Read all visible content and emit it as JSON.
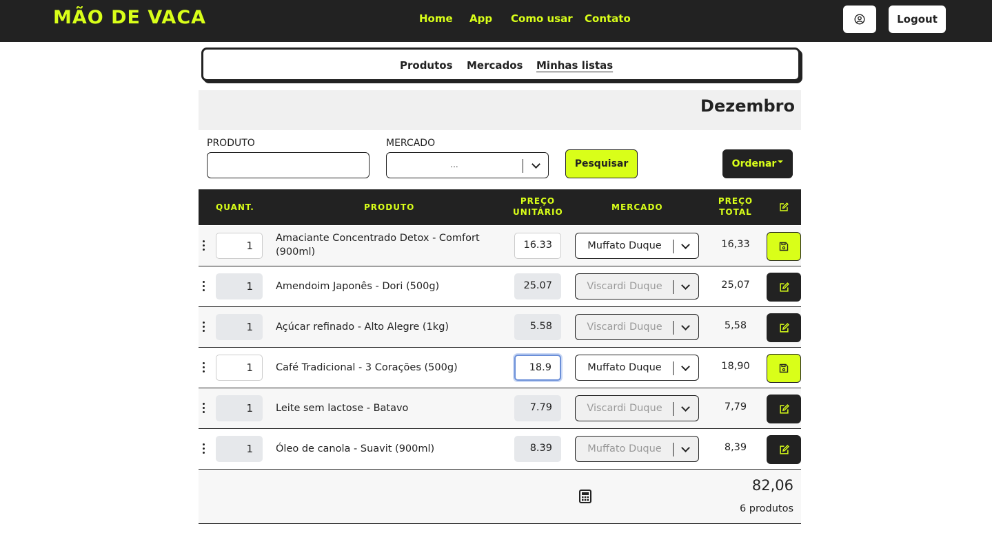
{
  "brand": {
    "logo": "MÃO DE VACA",
    "accent": "#d9ff19",
    "dark": "#222222"
  },
  "nav": {
    "home": "Home",
    "app": "App",
    "how": "Como usar",
    "contact": "Contato"
  },
  "header": {
    "user_icon": "user-circle-icon",
    "logout": "Logout"
  },
  "tabs": {
    "products": "Produtos",
    "markets": "Mercados",
    "lists": "Minhas listas",
    "active": "Minhas listas"
  },
  "list": {
    "title": "Dezembro"
  },
  "filters": {
    "product_label": "PRODUTO",
    "product_value": "",
    "market_label": "MERCADO",
    "market_value": "...",
    "search_button": "Pesquisar",
    "order_button": "Ordenar"
  },
  "table": {
    "headers": {
      "qty": "QUANT.",
      "product": "PRODUTO",
      "unit_price_1": "PREÇO",
      "unit_price_2": "UNITÁRIO",
      "market": "MERCADO",
      "total_1": "PREÇO",
      "total_2": "TOTAL",
      "edit_icon": "edit-icon"
    },
    "rows": [
      {
        "qty": "1",
        "product": "Amaciante Concentrado Detox - Comfort (900ml)",
        "price": "16.33",
        "market": "Muffato Duque",
        "total": "16,33",
        "mode": "editing"
      },
      {
        "qty": "1",
        "product": "Amendoim Japonês - Dori (500g)",
        "price": "25.07",
        "market": "Viscardi Duque",
        "total": "25,07",
        "mode": "readonly"
      },
      {
        "qty": "1",
        "product": "Açúcar refinado - Alto Alegre (1kg)",
        "price": "5.58",
        "market": "Viscardi Duque",
        "total": "5,58",
        "mode": "readonly"
      },
      {
        "qty": "1",
        "product": "Café Tradicional - 3 Corações (500g)",
        "price": "18.9",
        "market": "Muffato Duque",
        "total": "18,90",
        "mode": "editing"
      },
      {
        "qty": "1",
        "product": "Leite sem lactose - Batavo",
        "price": "7.79",
        "market": "Viscardi Duque",
        "total": "7,79",
        "mode": "readonly"
      },
      {
        "qty": "1",
        "product": "Óleo de canola - Suavit (900ml)",
        "price": "8.39",
        "market": "Muffato Duque",
        "total": "8,39",
        "mode": "readonly"
      }
    ]
  },
  "summary": {
    "total": "82,06",
    "count": "6 produtos",
    "icon": "calculator-icon"
  }
}
